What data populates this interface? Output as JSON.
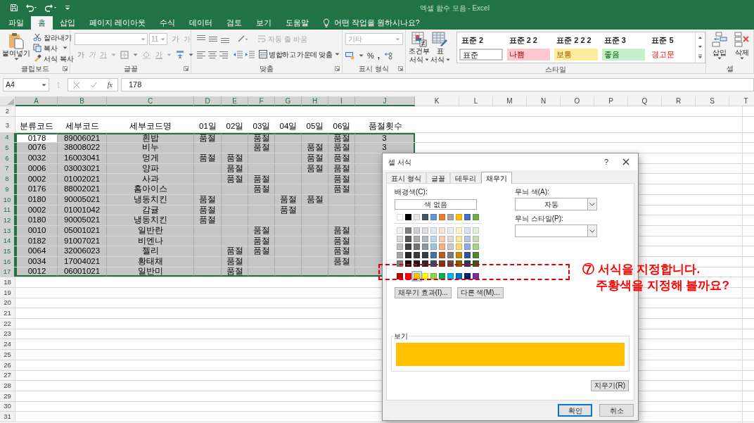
{
  "window": {
    "title": "엑셀 함수 모음 - Excel"
  },
  "tabs": [
    {
      "label": "파일",
      "selected": false
    },
    {
      "label": "홈",
      "selected": true
    },
    {
      "label": "삽입",
      "selected": false
    },
    {
      "label": "페이지 레이아웃",
      "selected": false
    },
    {
      "label": "수식",
      "selected": false
    },
    {
      "label": "데이터",
      "selected": false
    },
    {
      "label": "검토",
      "selected": false
    },
    {
      "label": "보기",
      "selected": false
    },
    {
      "label": "도움말",
      "selected": false
    }
  ],
  "search": {
    "placeholder": "어떤 작업을 원하시나요?"
  },
  "ribbon": {
    "clipboard": {
      "label": "클립보드",
      "paste": "붙여넣기",
      "cut": "잘라내기",
      "copy": "복사",
      "format_painter": "서식 복사"
    },
    "font": {
      "label": "글꼴",
      "disabled": true,
      "size": "11",
      "grow": "가",
      "shrink": "가",
      "bold": "가",
      "italic": "가",
      "underline": "가",
      "font_color": "가"
    },
    "alignment": {
      "label": "맞춤",
      "wrap_text": {
        "text": "자동 줄 바꿈",
        "disabled": true
      },
      "merge": "병합하고 가운데 맞춤"
    },
    "number": {
      "label": "표시 형식",
      "format": "기타",
      "percent": "%",
      "comma": ","
    },
    "styles": {
      "label": "스타일",
      "conditional_formatting": [
        "조건부",
        "서식"
      ],
      "format_as_table": [
        "표",
        "서식"
      ],
      "gallery": [
        {
          "label": "표준 2",
          "kind": "plain"
        },
        {
          "label": "표준 2 2",
          "kind": "plain"
        },
        {
          "label": "표준 2 2 2",
          "kind": "plain"
        },
        {
          "label": "표준 3",
          "kind": "plain"
        },
        {
          "label": "표준 5",
          "kind": "plain"
        },
        {
          "label": "표준",
          "kind": "normal"
        },
        {
          "label": "나쁨",
          "kind": "bad"
        },
        {
          "label": "보통",
          "kind": "neutral"
        },
        {
          "label": "좋음",
          "kind": "good"
        },
        {
          "label": "경고문",
          "kind": "warning"
        }
      ]
    },
    "cells": {
      "label": "셀",
      "insert": "삽입",
      "delete": "삭제"
    }
  },
  "formula_bar": {
    "name_box": "A4",
    "function_label": "fx",
    "value": "178"
  },
  "sheet": {
    "columns": [
      {
        "label": "A",
        "selected": true
      },
      {
        "label": "B",
        "selected": true
      },
      {
        "label": "C",
        "selected": true
      },
      {
        "label": "D",
        "selected": true
      },
      {
        "label": "E",
        "selected": true
      },
      {
        "label": "F",
        "selected": true
      },
      {
        "label": "G",
        "selected": true
      },
      {
        "label": "H",
        "selected": true
      },
      {
        "label": "I",
        "selected": true
      },
      {
        "label": "J",
        "selected": true
      },
      {
        "label": "K",
        "selected": false
      },
      {
        "label": "L",
        "selected": false
      },
      {
        "label": "M",
        "selected": false
      },
      {
        "label": "N",
        "selected": false
      },
      {
        "label": "O",
        "selected": false
      },
      {
        "label": "P",
        "selected": false
      },
      {
        "label": "Q",
        "selected": false
      },
      {
        "label": "R",
        "selected": false
      },
      {
        "label": "S",
        "selected": false
      },
      {
        "label": "T",
        "selected": false
      }
    ],
    "rows": [
      {
        "number": "2",
        "kind": "data",
        "selected": false
      },
      {
        "number": "3",
        "kind": "header",
        "selected": false,
        "cells": {
          "a": "분류코드",
          "b": "세부코드",
          "c": "세부코드명",
          "d": "01일",
          "e": "02일",
          "f": "03일",
          "g": "04일",
          "h": "05일",
          "i": "06일",
          "j": "품절횟수"
        }
      },
      {
        "number": "4",
        "kind": "data",
        "selected": true,
        "cells": {
          "a": {
            "text": "0178",
            "active": true
          },
          "b": "89006021",
          "c": "흰밥",
          "d": "품절",
          "f": "품절",
          "i": "품절",
          "j": "3"
        }
      },
      {
        "number": "5",
        "kind": "data",
        "selected": true,
        "cells": {
          "a": "0076",
          "b": "38008022",
          "c": "비누",
          "f": "품절",
          "h": "품절",
          "i": "품절",
          "j": "3"
        }
      },
      {
        "number": "6",
        "kind": "data",
        "selected": true,
        "cells": {
          "a": "0032",
          "b": "16003041",
          "c": "멍게",
          "d": "품절",
          "e": "품절",
          "h": "품절",
          "i": "품절"
        }
      },
      {
        "number": "7",
        "kind": "data",
        "selected": true,
        "cells": {
          "a": "0006",
          "b": "03003021",
          "c": "양파",
          "e": "품절",
          "h": "품절",
          "i": "품절"
        }
      },
      {
        "number": "8",
        "kind": "data",
        "selected": true,
        "cells": {
          "a": "0002",
          "b": "01002021",
          "c": "사과",
          "e": "품절",
          "f": "품절",
          "i": "품절"
        }
      },
      {
        "number": "9",
        "kind": "data",
        "selected": true,
        "cells": {
          "a": "0176",
          "b": "88002021",
          "c": "홈아이스",
          "f": "품절",
          "i": "품절"
        }
      },
      {
        "number": "10",
        "kind": "data",
        "selected": true,
        "cells": {
          "a": "0180",
          "b": "90005021",
          "c": "냉동치킨",
          "d": "품절",
          "g": "품절",
          "h": "품절"
        }
      },
      {
        "number": "11",
        "kind": "data",
        "selected": true,
        "cells": {
          "a": "0002",
          "b": "01001042",
          "c": "감귤",
          "d": "품절",
          "g": "품절"
        }
      },
      {
        "number": "12",
        "kind": "data",
        "selected": true,
        "cells": {
          "a": "0180",
          "b": "90005021",
          "c": "냉동치킨",
          "d": "품절"
        }
      },
      {
        "number": "13",
        "kind": "data",
        "selected": true,
        "cells": {
          "a": "0010",
          "b": "05001021",
          "c": "일반란",
          "f": "품절",
          "i": "품절"
        }
      },
      {
        "number": "14",
        "kind": "data",
        "selected": true,
        "cells": {
          "a": "0182",
          "b": "91007021",
          "c": "비엔나",
          "f": "품절",
          "i": "품절"
        }
      },
      {
        "number": "15",
        "kind": "data",
        "selected": true,
        "cells": {
          "a": "0064",
          "b": "32006023",
          "c": "젤리",
          "e": "품절",
          "f": "품절",
          "i": "품절"
        }
      },
      {
        "number": "16",
        "kind": "data",
        "selected": true,
        "cells": {
          "a": "0034",
          "b": "17004021",
          "c": "황태채",
          "e": "품절",
          "i": "품절"
        }
      },
      {
        "number": "17",
        "kind": "data",
        "selected": true,
        "cells": {
          "a": "0012",
          "b": "06001021",
          "c": "일반미",
          "e": "품절"
        }
      },
      {
        "number": "18",
        "kind": "data",
        "selected": false
      },
      {
        "number": "19",
        "kind": "data",
        "selected": false
      },
      {
        "number": "20",
        "kind": "data",
        "selected": false
      },
      {
        "number": "21",
        "kind": "data",
        "selected": false
      },
      {
        "number": "22",
        "kind": "data",
        "selected": false
      },
      {
        "number": "23",
        "kind": "data",
        "selected": false
      },
      {
        "number": "24",
        "kind": "data",
        "selected": false
      },
      {
        "number": "25",
        "kind": "data",
        "selected": false
      },
      {
        "number": "26",
        "kind": "data",
        "selected": false
      },
      {
        "number": "27",
        "kind": "data",
        "selected": false
      },
      {
        "number": "28",
        "kind": "data",
        "selected": false
      },
      {
        "number": "29",
        "kind": "data",
        "selected": false
      },
      {
        "number": "30",
        "kind": "data",
        "selected": false
      },
      {
        "number": "31",
        "kind": "data",
        "selected": false
      }
    ]
  },
  "dialog": {
    "title": "셀 서식",
    "help": "?",
    "tabs": [
      {
        "label": "표시 형식",
        "selected": false
      },
      {
        "label": "글꼴",
        "selected": false
      },
      {
        "label": "테두리",
        "selected": false
      },
      {
        "label": "채우기",
        "selected": true
      }
    ],
    "fill": {
      "background_label": "배경색(C):",
      "no_color": "색 없음",
      "theme_colors": [
        {
          "color": "#ffffff",
          "selected": false
        },
        {
          "color": "#000000",
          "selected": false
        },
        {
          "color": "#e7e6e6",
          "selected": false
        },
        {
          "color": "#44546a",
          "selected": false
        },
        {
          "color": "#5b9bd5",
          "selected": false
        },
        {
          "color": "#ed7d31",
          "selected": false
        },
        {
          "color": "#a5a5a5",
          "selected": false
        },
        {
          "color": "#ffc000",
          "selected": false
        },
        {
          "color": "#4472c4",
          "selected": false
        },
        {
          "color": "#70ad47",
          "selected": false
        }
      ],
      "standard_colors": [
        {
          "color": "#c00000",
          "selected": false
        },
        {
          "color": "#ff0000",
          "selected": false
        },
        {
          "color": "#ffc000",
          "selected": true
        },
        {
          "color": "#ffff00",
          "selected": false
        },
        {
          "color": "#92d050",
          "selected": false
        },
        {
          "color": "#00b050",
          "selected": false
        },
        {
          "color": "#00b0f0",
          "selected": false
        },
        {
          "color": "#0070c0",
          "selected": false
        },
        {
          "color": "#002060",
          "selected": false
        },
        {
          "color": "#7030a0",
          "selected": false
        }
      ],
      "fill_effects": "채우기 효과(I)...",
      "more_colors": "다른 색(M)...",
      "pattern_color_label": "무늬 색(A):",
      "pattern_color": "자동",
      "pattern_style_label": "무늬 스타일(P):",
      "sample_label": "보기",
      "clear": "지우기(R)"
    },
    "buttons": [
      {
        "label": "확인",
        "default": true
      },
      {
        "label": "취소",
        "default": false
      }
    ]
  },
  "annotation": {
    "lines": [
      "⑦ 서식을 지정합니다.",
      "주황색을 지정해 볼까요?"
    ]
  }
}
